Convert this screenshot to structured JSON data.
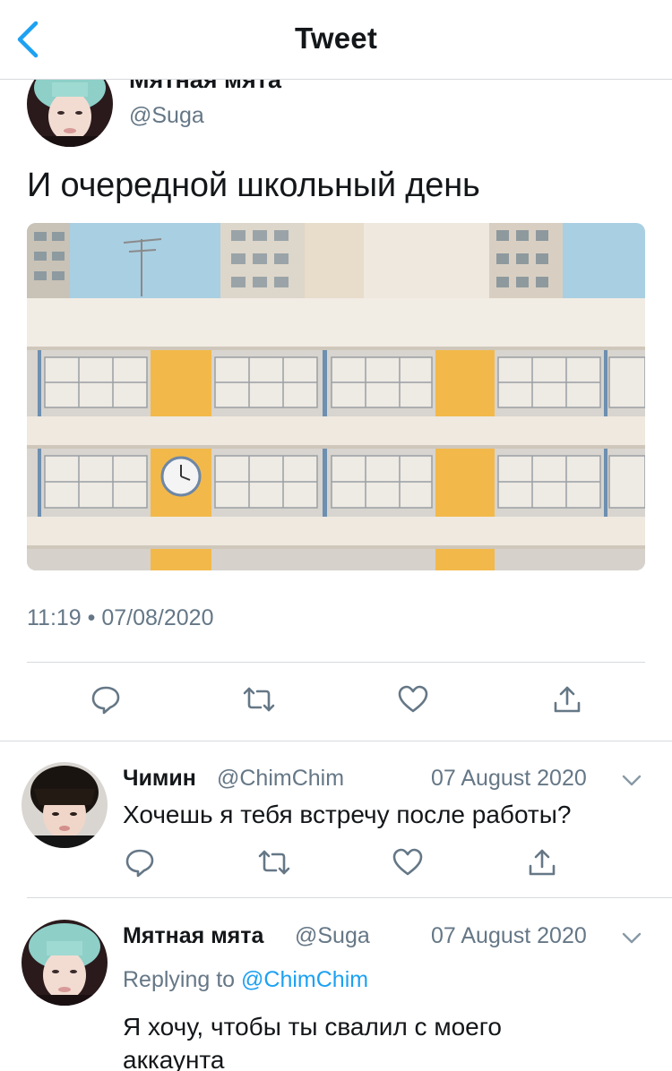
{
  "header": {
    "title": "Tweet",
    "back_icon": "chevron-left-icon",
    "accent": "#1da1f2"
  },
  "main_tweet": {
    "name": "Мятная мята",
    "handle": "@Suga",
    "text": "И очередной школьный день",
    "timestamp": "11:19 • 07/08/2020",
    "photo_icon": "school-building-photo"
  },
  "actions": [
    "reply-icon",
    "retweet-icon",
    "like-icon",
    "share-icon"
  ],
  "replies": [
    {
      "name": "Чимин",
      "handle": "@ChimChim",
      "date": "07 August 2020",
      "text": "Хочешь я тебя встречу после работы?"
    },
    {
      "name": "Мятная мята",
      "handle": "@Suga",
      "date": "07 August 2020",
      "replying_prefix": "Replying to",
      "replying_to": "@ChimChim",
      "text_line1": "Я хочу, чтобы ты свалил с моего",
      "text_line2": "аккаунта"
    }
  ]
}
